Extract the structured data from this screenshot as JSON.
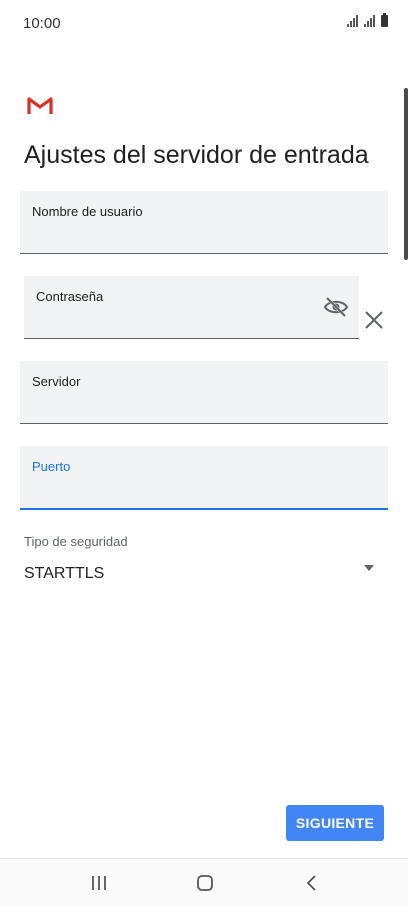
{
  "status_bar": {
    "time": "10:00"
  },
  "screen": {
    "title": "Ajustes del servidor de entrada"
  },
  "form": {
    "username": {
      "label": "Nombre de usuario",
      "value": ""
    },
    "password": {
      "label": "Contraseña",
      "value": ""
    },
    "server": {
      "label": "Servidor",
      "value": ""
    },
    "port": {
      "label": "Puerto",
      "value": ""
    },
    "security": {
      "label": "Tipo de seguridad",
      "value": "STARTTLS"
    }
  },
  "actions": {
    "next_label": "SIGUIENTE"
  },
  "icons": {
    "logo": "gmail-logo",
    "password_visibility": "eye-off-icon",
    "clear": "close-icon",
    "dropdown": "caret-down-icon",
    "nav_recents": "recents-icon",
    "nav_home": "home-icon",
    "nav_back": "back-icon"
  },
  "colors": {
    "accent": "#1a73e8",
    "button": "#4285f4",
    "field_background": "#f1f3f4"
  }
}
